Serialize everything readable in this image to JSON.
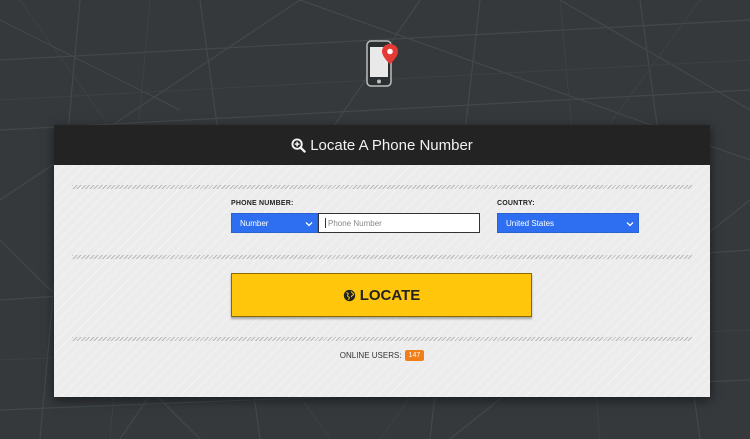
{
  "header": {
    "title": "Locate A Phone Number",
    "icon": "search-plus-icon"
  },
  "app_icon": "phone-location-icon",
  "form": {
    "phone_label": "PHONE NUMBER:",
    "type_select_value": "Number",
    "phone_placeholder": "Phone Number",
    "phone_value": "",
    "country_label": "COUNTRY:",
    "country_value": "United States"
  },
  "locate_button": {
    "label": "LOCATE",
    "icon": "globe-icon"
  },
  "online": {
    "label": "ONLINE USERS:",
    "count": "147"
  },
  "colors": {
    "background": "#35393c",
    "header": "#232323",
    "panel": "#ececec",
    "select": "#2d6ff0",
    "button": "#ffc60b",
    "badge": "#f07f1a",
    "pin": "#e53935"
  }
}
